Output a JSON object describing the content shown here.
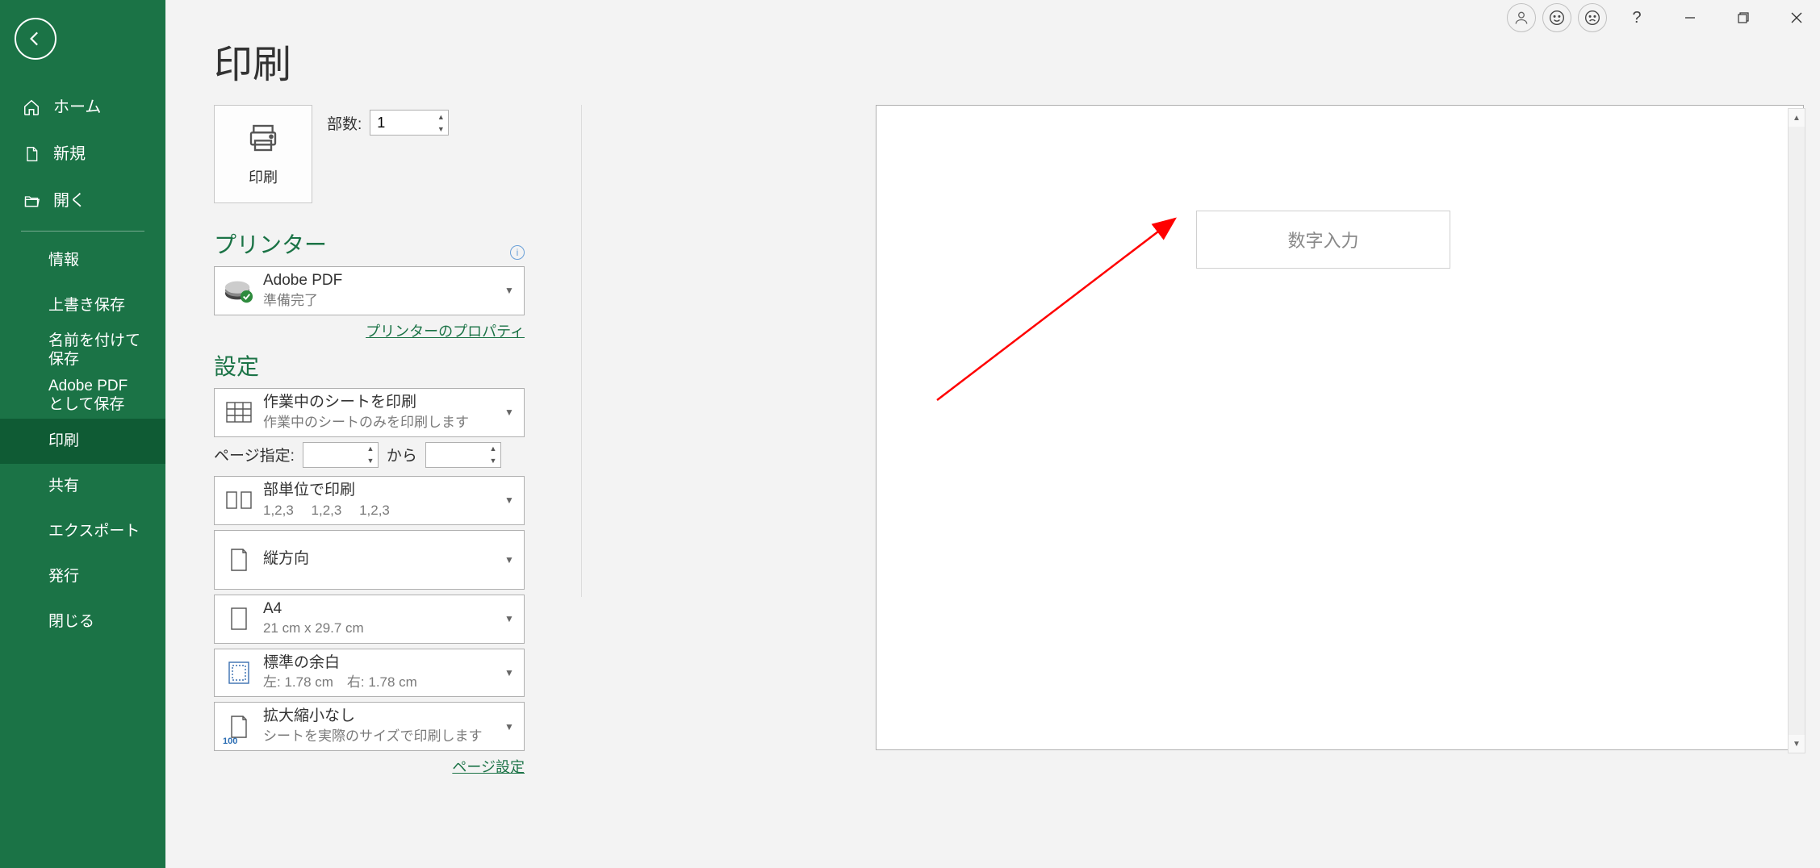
{
  "titlebar": {
    "help": "?",
    "minimize": "minimize",
    "restore": "restore",
    "close": "close"
  },
  "sidebar": {
    "home": "ホーム",
    "new": "新規",
    "open": "開く",
    "info": "情報",
    "save": "上書き保存",
    "saveas": "名前を付けて保存",
    "adobepdf": "Adobe PDF として保存",
    "print": "印刷",
    "share": "共有",
    "export": "エクスポート",
    "publish": "発行",
    "close": "閉じる"
  },
  "page": {
    "title": "印刷"
  },
  "print": {
    "button": "印刷",
    "copies_label": "部数:",
    "copies_value": "1"
  },
  "printer": {
    "heading": "プリンター",
    "name": "Adobe PDF",
    "status": "準備完了",
    "props_link": "プリンターのプロパティ"
  },
  "settings": {
    "heading": "設定",
    "what": {
      "l1": "作業中のシートを印刷",
      "l2": "作業中のシートのみを印刷します"
    },
    "range_label": "ページ指定:",
    "range_from": "",
    "range_to_label": "から",
    "range_to": "",
    "collate": {
      "l1": "部単位で印刷",
      "l2": "1,2,3　 1,2,3　 1,2,3"
    },
    "orient": {
      "l1": "縦方向"
    },
    "paper": {
      "l1": "A4",
      "l2": "21 cm x 29.7 cm"
    },
    "margin": {
      "l1": "標準の余白",
      "l2": "左: 1.78 cm　右: 1.78 cm"
    },
    "scale": {
      "l1": "拡大縮小なし",
      "l2": "シートを実際のサイズで印刷します",
      "badge": "100"
    },
    "page_setup_link": "ページ設定"
  },
  "preview": {
    "cell_text": "数字入力"
  }
}
